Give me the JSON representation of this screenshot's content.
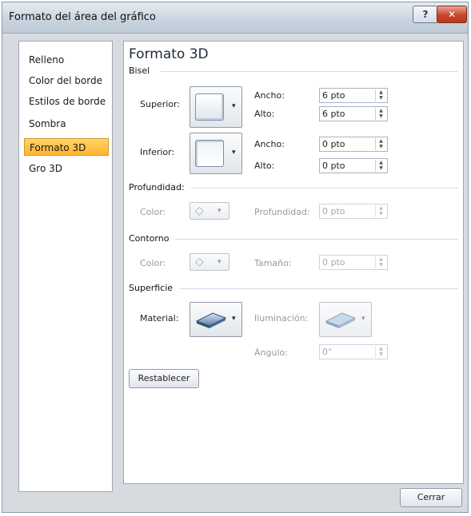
{
  "window": {
    "title": "Formato del área del gráfico",
    "help_glyph": "?",
    "close_glyph": "✕"
  },
  "sidebar": {
    "items": [
      {
        "label": "Relleno"
      },
      {
        "label": "Color del borde"
      },
      {
        "label": "Estilos de borde"
      },
      {
        "label": "Sombra"
      },
      {
        "label": "Formato 3D",
        "active": true
      },
      {
        "label": "Gro 3D"
      }
    ]
  },
  "panel": {
    "title": "Formato 3D",
    "bisel": {
      "section_label": "Bisel",
      "superior_label": "Superior:",
      "inferior_label": "Inferior:",
      "ancho_label": "Ancho:",
      "alto_label": "Alto:",
      "superior_ancho": "6 pto",
      "superior_alto": "6 pto",
      "inferior_ancho": "0 pto",
      "inferior_alto": "0 pto"
    },
    "profundidad": {
      "section_label": "Profundidad:",
      "color_label": "Color:",
      "depth_label": "Profundidad:",
      "depth_value": "0 pto"
    },
    "contorno": {
      "section_label": "Contorno",
      "color_label": "Color:",
      "size_label": "Tamaño:",
      "size_value": "0 pto"
    },
    "superficie": {
      "section_label": "Superficie",
      "material_label": "Material:",
      "lighting_label": "Iluminación:",
      "angle_label": "Ángulo:",
      "angle_value": "0°"
    },
    "reset_label": "Restablecer"
  },
  "footer": {
    "close_label": "Cerrar"
  },
  "icons": {
    "dropdown": "▾",
    "spin_up": "▲",
    "spin_down": "▼"
  },
  "colors": {
    "active_tab": "#ffc444",
    "title_bar": "#c9d3df",
    "close_button": "#c8452b"
  }
}
